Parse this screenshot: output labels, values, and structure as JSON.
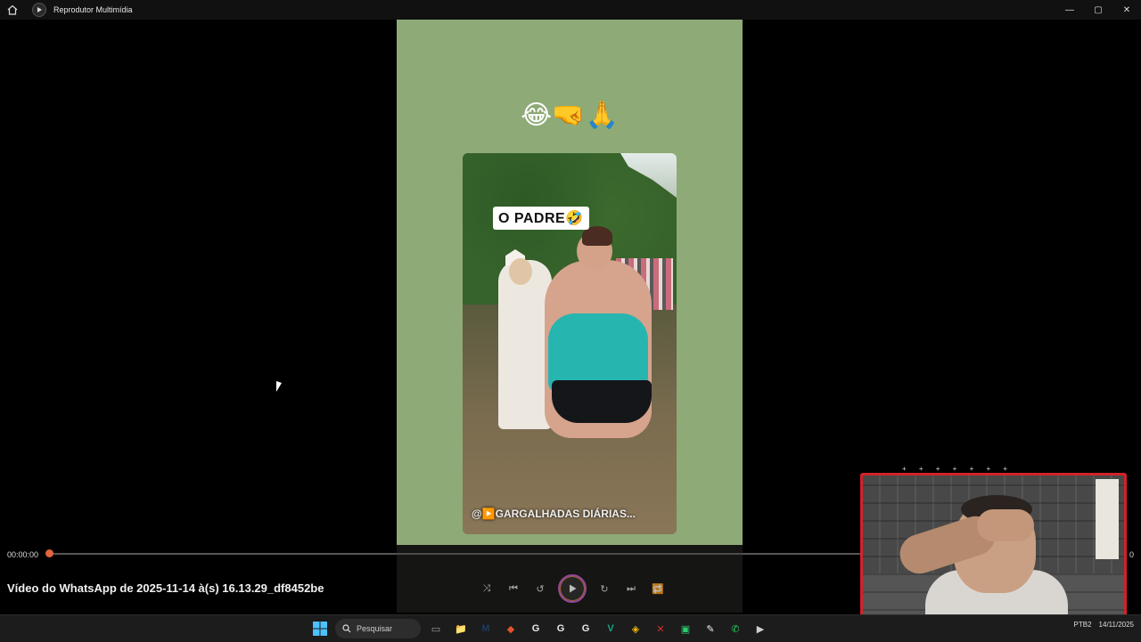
{
  "window": {
    "app_title": "Reprodutor Multimídia",
    "controls": {
      "minimize": "—",
      "maximize": "▢",
      "close": "✕"
    }
  },
  "video": {
    "emojis": "😂🤜🙏",
    "caption_tag": "O PADRE🤣",
    "watermark": "@▶️GARGALHADAS DIÁRIAS..."
  },
  "player": {
    "current_time": "00:00:00",
    "end_time": "0",
    "progress": 0,
    "file_name": "Vídeo do WhatsApp de 2025-11-14 à(s) 16.13.29_df8452be",
    "buttons": {
      "shuffle": "⤨",
      "previous": "⏮",
      "rewind": "↺",
      "play": "▶",
      "forward": "↻",
      "next": "⏭",
      "repeat": "🔁"
    }
  },
  "taskbar": {
    "search_placeholder": "Pesquisar",
    "tray_lang": "PTB2",
    "tray_date": "14/11/2025",
    "apps": [
      {
        "name": "task-view",
        "glyph": "▭",
        "color": "#9aa0a6"
      },
      {
        "name": "file-explorer",
        "glyph": "📁",
        "color": "#f2c14e"
      },
      {
        "name": "app-m",
        "glyph": "M",
        "color": "#1e3a5f"
      },
      {
        "name": "brave",
        "glyph": "◆",
        "color": "#e0532c"
      },
      {
        "name": "chrome-1",
        "glyph": "G",
        "color": "#e8e8e8"
      },
      {
        "name": "chrome-2",
        "glyph": "G",
        "color": "#e8e8e8"
      },
      {
        "name": "chrome-3",
        "glyph": "G",
        "color": "#e8e8e8"
      },
      {
        "name": "app-v",
        "glyph": "V",
        "color": "#17a589"
      },
      {
        "name": "binance",
        "glyph": "◈",
        "color": "#f0b90b"
      },
      {
        "name": "app-x",
        "glyph": "✕",
        "color": "#d32f2f"
      },
      {
        "name": "app-green",
        "glyph": "▣",
        "color": "#2ecc71"
      },
      {
        "name": "app-pen",
        "glyph": "✎",
        "color": "#eeeeee"
      },
      {
        "name": "whatsapp",
        "glyph": "✆",
        "color": "#25d366"
      },
      {
        "name": "media-player",
        "glyph": "▶",
        "color": "#cfcfcf"
      }
    ]
  }
}
